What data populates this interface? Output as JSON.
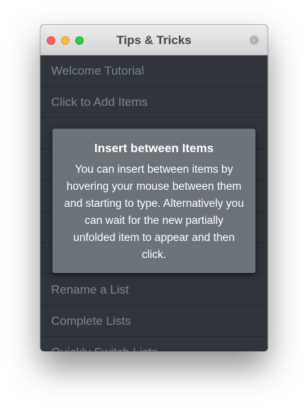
{
  "window": {
    "title": "Tips & Tricks",
    "settings_icon": "gear-icon"
  },
  "list": {
    "items": [
      {
        "label": "Welcome Tutorial"
      },
      {
        "label": "Click to Add Items"
      },
      {
        "label": ""
      },
      {
        "label": ""
      },
      {
        "label": ""
      },
      {
        "label": ""
      },
      {
        "label": ""
      },
      {
        "label": "Rename a List"
      },
      {
        "label": "Complete Lists"
      },
      {
        "label": "Quickly Switch Lists"
      }
    ]
  },
  "popover": {
    "title": "Insert between Items",
    "body": "You can insert between items by hovering your mouse between them and starting to type. Alternatively you can wait for the new partially unfolded item to appear and then click."
  },
  "colors": {
    "list_background": "#30353c",
    "item_text": "#7c838b",
    "popover_background": "#6b737b",
    "close": "#fc605c",
    "minimize": "#fdbc40",
    "zoom": "#34c84a"
  }
}
